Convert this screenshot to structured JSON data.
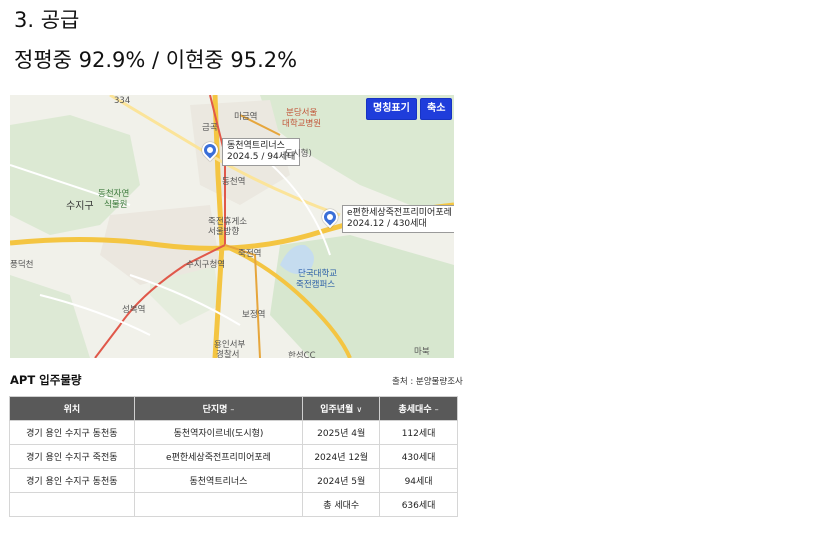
{
  "heading": {
    "title": "3. 공급",
    "rates": "정평중 92.9% / 이현중 95.2%"
  },
  "map": {
    "buttons": {
      "names": "명칭표기",
      "zoom": "축소"
    },
    "markers": [
      {
        "name": "동천역트리너스",
        "detail": "2024.5 / 94세대"
      },
      {
        "name": "e편한세상죽전프리미어포레",
        "detail": "2024.12 / 430세대"
      }
    ],
    "places": {
      "road_sign": "334",
      "migeum": "미금역",
      "bundang": "분당서울",
      "bundang2": "대학교병원",
      "geumgok": "금곡",
      "dongcheon": "동천역",
      "park": "동천자연",
      "park2": "식물원",
      "sujigu": "수지구",
      "rest": "죽전휴게소",
      "rest2": "서울방향",
      "jukjeon": "죽전역",
      "suji_office": "수지구청역",
      "dankook": "단국대학교",
      "dankook2": "죽전캠퍼스",
      "seongbok": "성복역",
      "bojeong": "보정역",
      "police": "용인서부",
      "police2": "경찰서",
      "golf": "한성CC",
      "mabuk": "마북",
      "partial_left": "풍덕천",
      "partial_label": "도시형)"
    }
  },
  "table": {
    "title": "APT 입주물량",
    "source": "출처 : 분양물량조사",
    "headers": {
      "location": "위치",
      "complex": "단지명",
      "date": "입주년월",
      "units": "총세대수"
    },
    "arrows": {
      "complex": "–",
      "date": "∨",
      "units": "–"
    },
    "rows": [
      {
        "location": "경기 용인 수지구 동천동",
        "complex": "동천역자이르네(도시형)",
        "date": "2025년 4월",
        "units": "112세대"
      },
      {
        "location": "경기 용인 수지구 죽전동",
        "complex": "e편한세상죽전프리미어포레",
        "date": "2024년 12월",
        "units": "430세대"
      },
      {
        "location": "경기 용인 수지구 동천동",
        "complex": "동천역트리너스",
        "date": "2024년 5월",
        "units": "94세대"
      }
    ],
    "total": {
      "label": "총 세대수",
      "value": "636세대"
    }
  },
  "colors": {
    "button": "#1f3ddb",
    "header": "#595959",
    "marker": "#3a6fd8"
  }
}
